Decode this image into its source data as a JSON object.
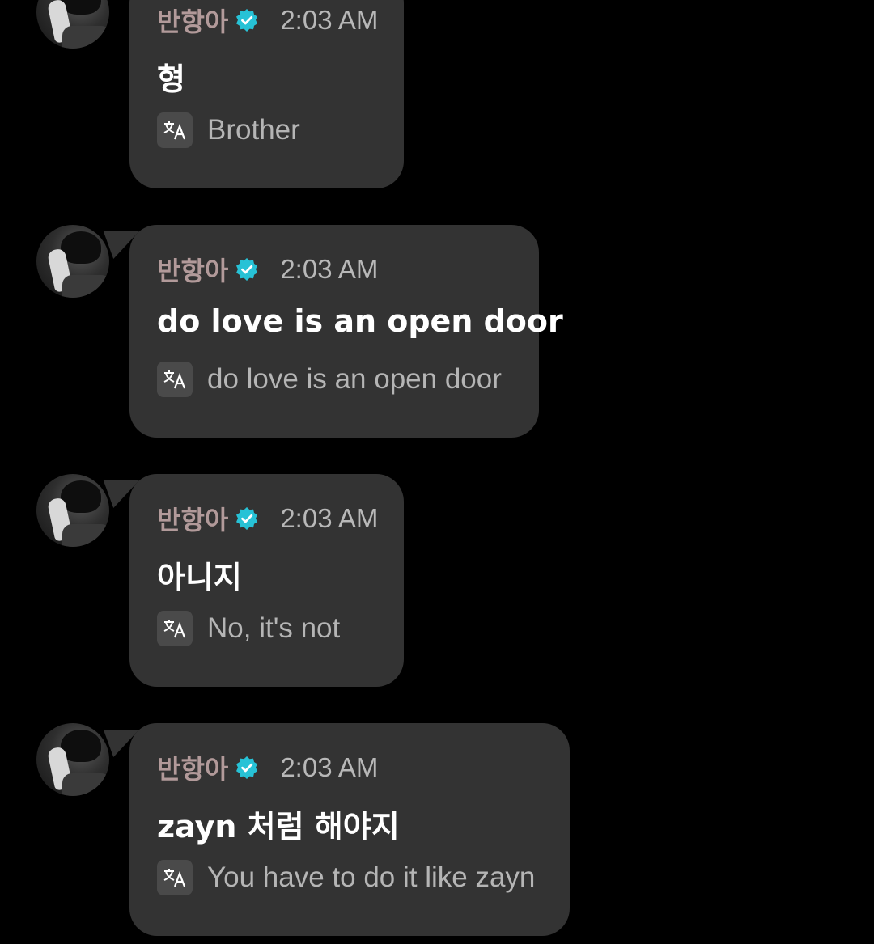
{
  "messages": [
    {
      "sender": "반항아",
      "time": "2:03 AM",
      "text": "형",
      "translation": "Brother"
    },
    {
      "sender": "반항아",
      "time": "2:03 AM",
      "text": "do love is an open door",
      "translation": "do love is an open door"
    },
    {
      "sender": "반항아",
      "time": "2:03 AM",
      "text": "아니지",
      "translation": "No, it's not"
    },
    {
      "sender": "반항아",
      "time": "2:03 AM",
      "text": "zayn 처럼 해야지",
      "translation": "You have to do it like zayn"
    }
  ],
  "icons": {
    "verified": "verified-badge-icon",
    "translate": "translate-icon"
  },
  "colors": {
    "background": "#000000",
    "bubble": "#333333",
    "sender": "#b29a9a",
    "verified": "#27c2d6",
    "message_text": "#ffffff",
    "secondary_text": "#b5b5b5"
  }
}
